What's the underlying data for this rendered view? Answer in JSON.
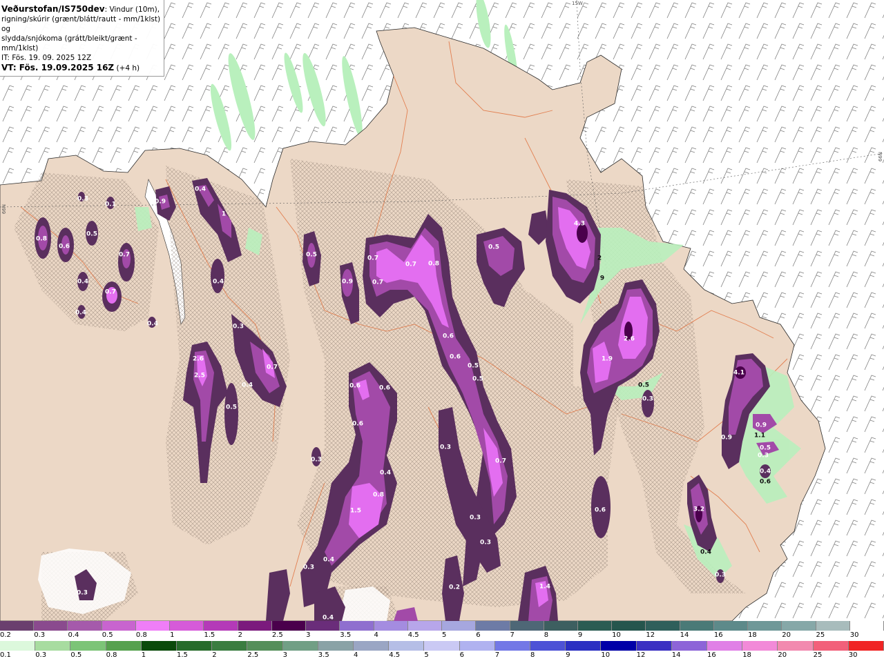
{
  "header": {
    "source": "Veðurstofan/IS750dev",
    "desc1": ": Vindur (10m),",
    "desc2": "rigning/skúrir (grænt/blátt/rautt - mm/1klst) og",
    "desc3": "slydda/snjókoma (grátt/bleikt/grænt - mm/1klst)",
    "it": "IT: Fös. 19. 09. 2025 12Z",
    "vt_prefix": "VT:",
    "vt": " Fös. 19.09.2025 16Z",
    "vt_suffix": " (+4 h)"
  },
  "grid_labels": {
    "top": "15W",
    "right": "66N",
    "left": "66N"
  },
  "colors": {
    "sea": "#ffffff",
    "land": "#ecd8c6",
    "roads": "#e0703c",
    "precip_dark": "#5a2f5e",
    "precip_mid": "#a24aa8",
    "precip_light": "#e36ef0",
    "rain_green": "#b9f0bd"
  },
  "map_values": [
    "0.4",
    "0.3",
    "0.1",
    "0.9",
    "1",
    "0.8",
    "0.6",
    "0.5",
    "0.7",
    "0.4",
    "0.7",
    "0.4",
    "0.4",
    "0.4",
    "0.5",
    "0.5",
    "0.3",
    "0.7",
    "2.6",
    "2.5",
    "0.4",
    "0.5",
    "0.3",
    "0.5",
    "0.9",
    "0.7",
    "0.7",
    "0.7",
    "0.8",
    "0.6",
    "0.6",
    "0.5",
    "0.6",
    "0.6",
    "0.6",
    "0.4",
    "0.8",
    "1.5",
    "0.4",
    "0.3",
    "0.3",
    "0.7",
    "0.3",
    "0.3",
    "0.4",
    "0.2",
    "1.4",
    "0.5",
    "4.3",
    "2",
    "9",
    "2.6",
    "1.9",
    "0.5",
    "0.3",
    "0.6",
    "4.1",
    "0.9",
    "0.9",
    "1.1",
    "0.5",
    "0.3",
    "0.4",
    "0.6",
    "3.2",
    "0.4",
    "0.3",
    "0.3"
  ],
  "legend_rain": {
    "labels": [
      "0.2",
      "0.3",
      "0.4",
      "0.5",
      "0.8",
      "1",
      "1.5",
      "2",
      "2.5",
      "3",
      "3.5",
      "4",
      "4.5",
      "5",
      "6",
      "7",
      "8",
      "9",
      "10",
      "12",
      "14",
      "16",
      "18",
      "20",
      "25",
      "30"
    ],
    "colors": [
      "#6a3f6e",
      "#8a4a8e",
      "#a55aab",
      "#c864cf",
      "#ef7ef7",
      "#d65ad9",
      "#b43ab8",
      "#7b1a7d",
      "#4a004c",
      "#6a2d7a",
      "#8f6fcf",
      "#a48ce0",
      "#b7a6ea",
      "#a6a7df",
      "#6d7ba6",
      "#4e6776",
      "#3d5f60",
      "#2b5c53",
      "#25554d",
      "#2f5f5b",
      "#4a7a77",
      "#5d8a8a",
      "#6f9898",
      "#86a8a8",
      "#a8bcbc",
      "#ffffff"
    ]
  },
  "legend_snow": {
    "labels": [
      "0.1",
      "0.3",
      "0.5",
      "0.8",
      "1",
      "1.5",
      "2",
      "2.5",
      "3",
      "3.5",
      "4",
      "4.5",
      "5",
      "6",
      "7",
      "8",
      "9",
      "10",
      "12",
      "14",
      "16",
      "18",
      "20",
      "25",
      "30"
    ],
    "colors": [
      "#dcf8dc",
      "#a8dca0",
      "#7cc477",
      "#56a14e",
      "#0b4a0b",
      "#276b2b",
      "#3a7d40",
      "#558f5a",
      "#719f85",
      "#8aa2a6",
      "#9aa6c4",
      "#b5bee6",
      "#cac9f4",
      "#b0b2f0",
      "#7378e6",
      "#4d52d6",
      "#2b2fc2",
      "#0000a8",
      "#3a2fc2",
      "#8d64d8",
      "#e080e6",
      "#f28ad8",
      "#f28aaf",
      "#f2607a",
      "#f02424"
    ]
  }
}
